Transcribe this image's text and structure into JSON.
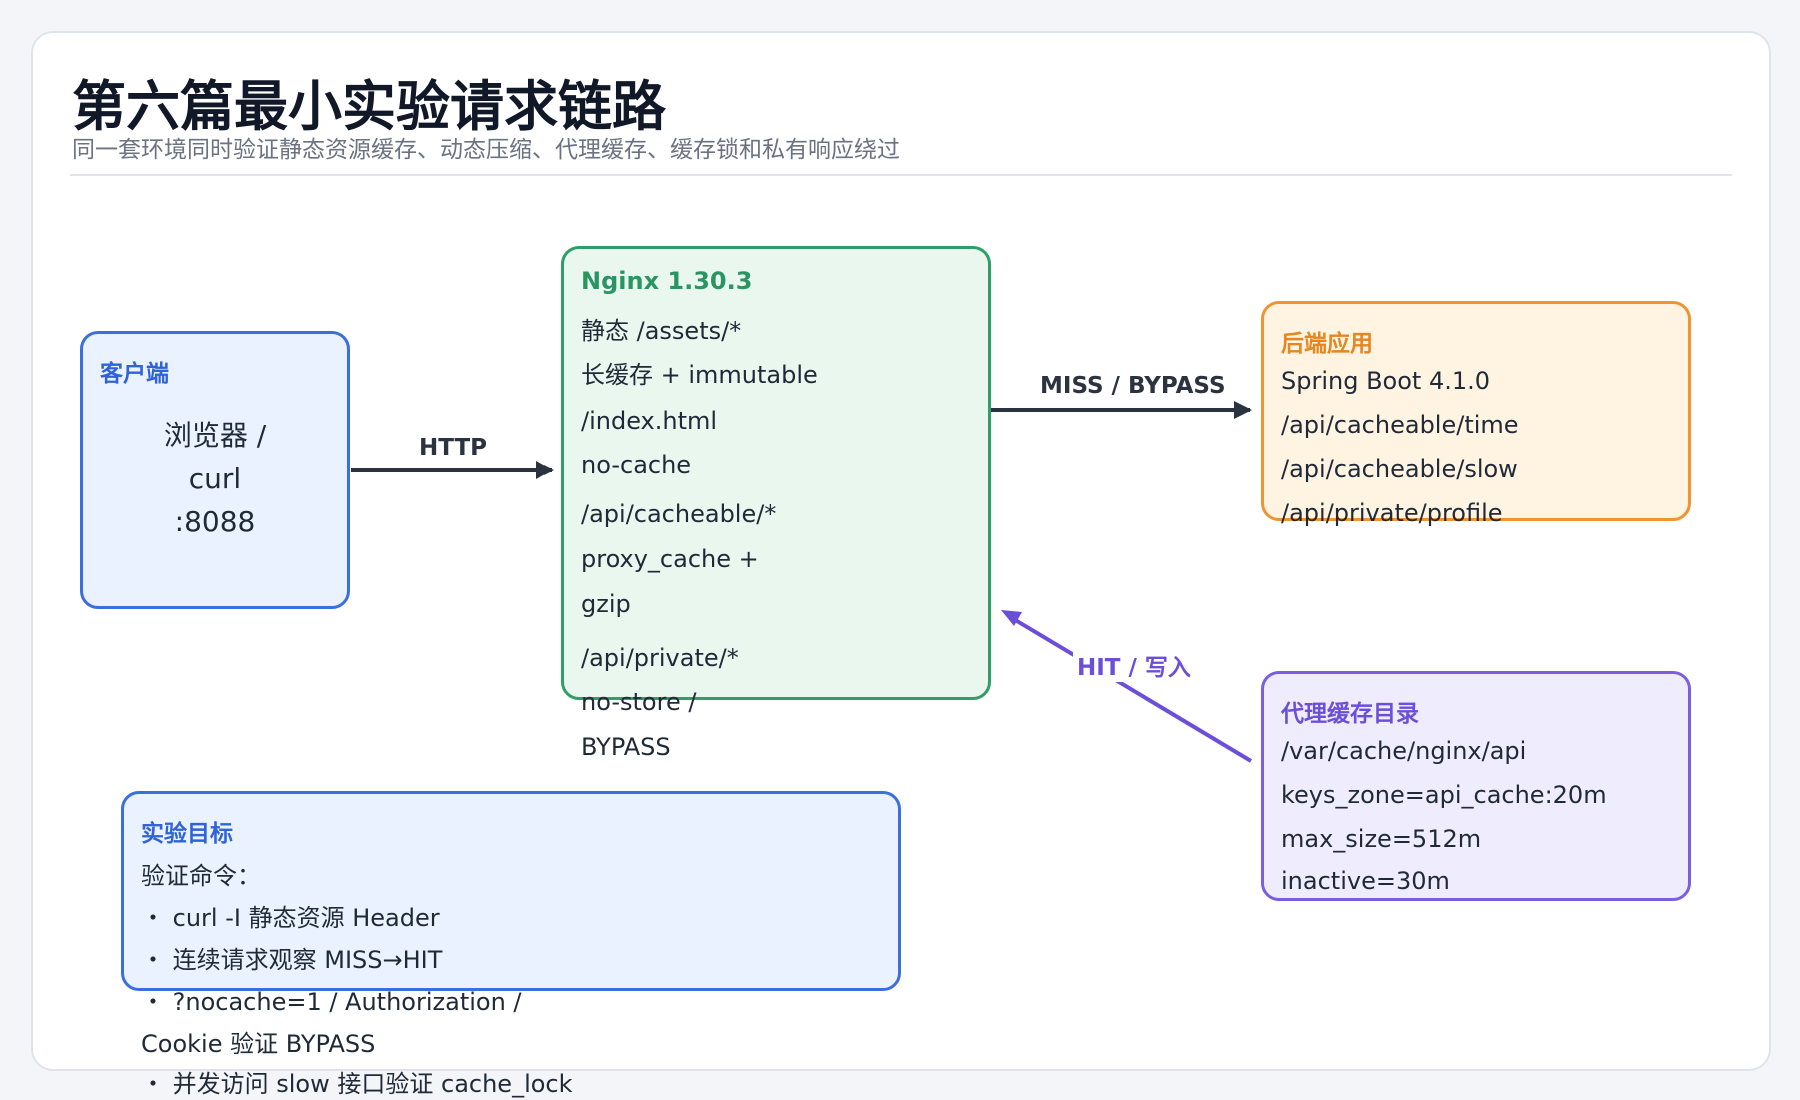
{
  "title": "第六篇最小实验请求链路",
  "subtitle": "同一套环境同时验证静态资源缓存、动态压缩、代理缓存、缓存锁和私有响应绕过",
  "client": {
    "heading": "客户端",
    "lines": [
      "浏览器 /",
      "curl",
      ":8088"
    ]
  },
  "nginx": {
    "heading": "Nginx 1.30.3",
    "lines": [
      "静态 /assets/*",
      "长缓存 + immutable",
      "/index.html",
      "no-cache",
      "/api/cacheable/*",
      "proxy_cache +",
      "gzip",
      "/api/private/*",
      "no-store /",
      "BYPASS"
    ]
  },
  "backend": {
    "heading": "后端应用",
    "lines": [
      "Spring Boot 4.1.0",
      "/api/cacheable/time",
      "/api/cacheable/slow",
      "/api/private/profile"
    ]
  },
  "cache_dir": {
    "heading": "代理缓存目录",
    "lines": [
      "/var/cache/nginx/api",
      "keys_zone=api_cache:20m",
      "max_size=512m",
      "inactive=30m"
    ]
  },
  "goal": {
    "heading": "实验目标",
    "lines": [
      "验证命令：",
      "・ curl -I 静态资源 Header",
      "・ 连续请求观察 MISS→HIT",
      "・ ?nocache=1 / Authorization /",
      "Cookie 验证 BYPASS",
      "・ 并发访问 slow 接口验证 cache_lock"
    ]
  },
  "edges": {
    "client_to_nginx": "HTTP",
    "nginx_to_backend": "MISS / BYPASS",
    "cache_to_nginx": "HIT / 写入"
  },
  "colors": {
    "blue": "#3b6fe0",
    "green": "#2f9e69",
    "orange": "#ee9432",
    "purple": "#7b5fe0",
    "arrow_dark": "#2b3340"
  }
}
